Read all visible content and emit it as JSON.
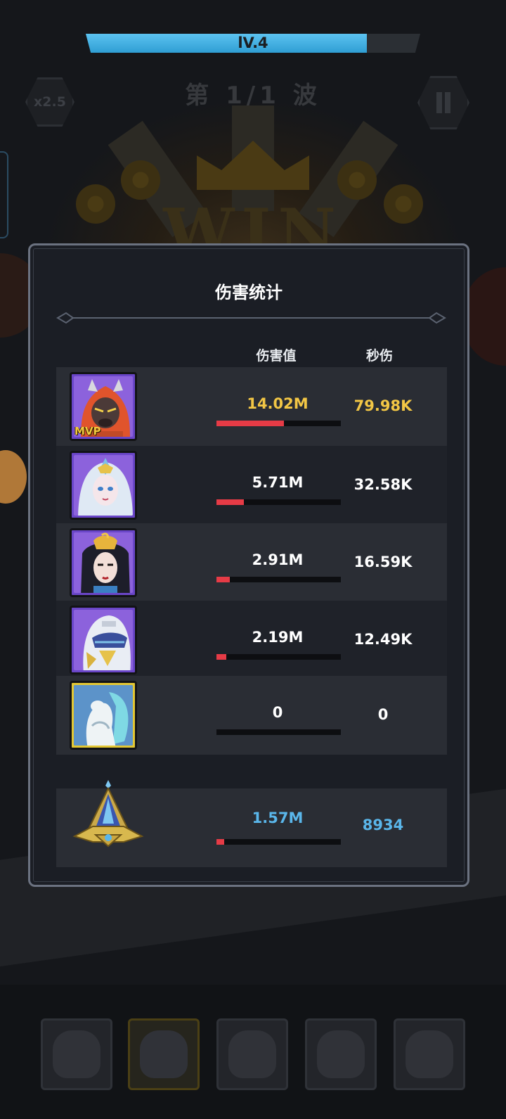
{
  "hud": {
    "level_label": "lV.4",
    "level_progress": 0.84,
    "speed_label": "x2.5",
    "wave_label": "第 1/1 波"
  },
  "background": {
    "result_text": "WIN"
  },
  "panel": {
    "title": "伤害统计",
    "col_damage": "伤害值",
    "col_dps": "秒伤",
    "rows": [
      {
        "damage": "14.02M",
        "dps": "79.98K",
        "share": 0.54,
        "mvp": "MVP",
        "portrait": "lion-warrior",
        "frame": "purple",
        "highlight": "gold"
      },
      {
        "damage": "5.71M",
        "dps": "32.58K",
        "share": 0.22,
        "portrait": "ice-queen",
        "frame": "purple",
        "highlight": "white"
      },
      {
        "damage": "2.91M",
        "dps": "16.59K",
        "share": 0.11,
        "portrait": "pharaoh-lady",
        "frame": "purple",
        "highlight": "white"
      },
      {
        "damage": "2.19M",
        "dps": "12.49K",
        "share": 0.08,
        "portrait": "silver-knight",
        "frame": "purple",
        "highlight": "white"
      },
      {
        "damage": "0",
        "dps": "0",
        "share": 0.0,
        "portrait": "spirit-creature",
        "frame": "gold",
        "highlight": "white"
      }
    ],
    "artifact": {
      "damage": "1.57M",
      "dps": "8934",
      "share": 0.06,
      "icon": "crystal-pyramid-icon",
      "highlight": "blue"
    }
  },
  "colors": {
    "accent_gold": "#f2c645",
    "accent_blue": "#5ab6ea",
    "bar_red": "#e63b46",
    "level_blue": "#3aa9df",
    "frame_purple": "#6a46c8",
    "frame_gold": "#e3c733"
  }
}
